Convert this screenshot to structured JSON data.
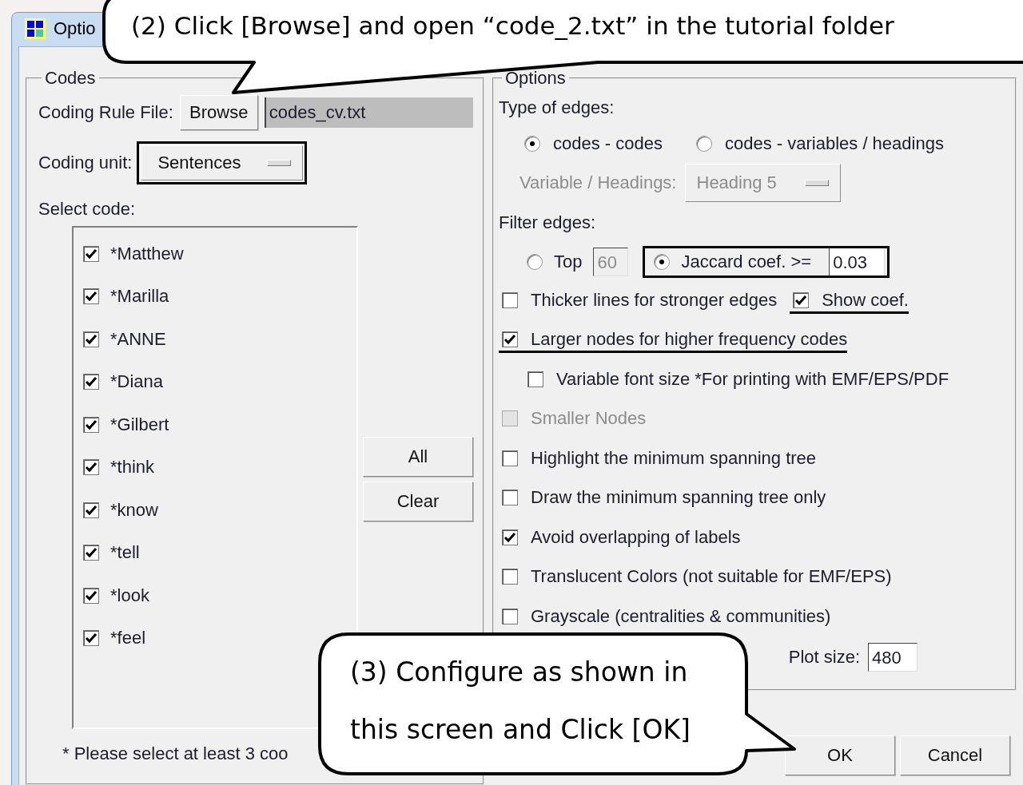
{
  "window": {
    "title": "Optio"
  },
  "codes_group": {
    "legend": "Codes",
    "coding_rule_file_label": "Coding Rule File:",
    "browse_button": "Browse",
    "file_field": "codes_cv.txt",
    "coding_unit": {
      "label": "Coding unit:",
      "value": "Sentences",
      "boxed": true
    },
    "select_code_label": "Select code:",
    "codes": [
      {
        "label": "*Matthew",
        "checked": true
      },
      {
        "label": "*Marilla",
        "checked": true
      },
      {
        "label": "*ANNE",
        "checked": true
      },
      {
        "label": "*Diana",
        "checked": true
      },
      {
        "label": "*Gilbert",
        "checked": true
      },
      {
        "label": "*think",
        "checked": true
      },
      {
        "label": "*know",
        "checked": true
      },
      {
        "label": "*tell",
        "checked": true
      },
      {
        "label": "*look",
        "checked": true
      },
      {
        "label": "*feel",
        "checked": true
      }
    ],
    "all_button": "All",
    "clear_button": "Clear",
    "note": "* Please select at least 3 coo"
  },
  "options_group": {
    "legend": "Options",
    "type_of_edges_label": "Type of edges:",
    "edge_types": [
      {
        "label": "codes - codes",
        "selected": true
      },
      {
        "label": "codes - variables / headings",
        "selected": false
      }
    ],
    "variable": {
      "label": "Variable / Headings:",
      "value": "Heading 5",
      "disabled": true
    },
    "filter_edges_label": "Filter edges:",
    "filters": [
      {
        "label": "Top",
        "value": "60",
        "selected": false,
        "disabled": true
      },
      {
        "label": "Jaccard coef. >=",
        "value": "0.03",
        "selected": true,
        "disabled": false,
        "boxed": true
      }
    ],
    "option_rows": [
      {
        "items": [
          {
            "label": "Thicker lines for stronger edges",
            "checked": false,
            "disabled": false
          },
          {
            "label": "Show coef.",
            "checked": true,
            "disabled": false,
            "underlined": true
          }
        ]
      },
      {
        "items": [
          {
            "label": "Larger nodes for higher frequency codes",
            "checked": true,
            "disabled": false,
            "underlined": true
          }
        ],
        "children": [
          {
            "items": [
              {
                "label": "Variable font size *For printing with EMF/EPS/PDF",
                "checked": false,
                "disabled": false
              }
            ]
          }
        ]
      },
      {
        "items": [
          {
            "label": "Smaller Nodes",
            "checked": false,
            "disabled": true
          }
        ]
      },
      {
        "items": [
          {
            "label": "Highlight the minimum spanning tree",
            "checked": false,
            "disabled": false
          }
        ]
      },
      {
        "items": [
          {
            "label": "Draw the minimum spanning tree only",
            "checked": false,
            "disabled": false
          }
        ]
      },
      {
        "items": [
          {
            "label": "Avoid overlapping of labels",
            "checked": true,
            "disabled": false
          }
        ]
      },
      {
        "items": [
          {
            "label": "Translucent Colors (not suitable for EMF/EPS)",
            "checked": false,
            "disabled": false
          }
        ]
      },
      {
        "items": [
          {
            "label": "Grayscale (centralities & communities)",
            "checked": false,
            "disabled": false
          }
        ]
      }
    ],
    "plot_size": {
      "label": "Plot size:",
      "value": "480"
    }
  },
  "buttons": [
    "OK",
    "Cancel"
  ],
  "callouts": [
    {
      "text": "(2) Click [Browse] and open “code_2.txt” in the tutorial folder"
    },
    {
      "text": "(3) Configure as shown in this screen and Click [OK]"
    }
  ]
}
